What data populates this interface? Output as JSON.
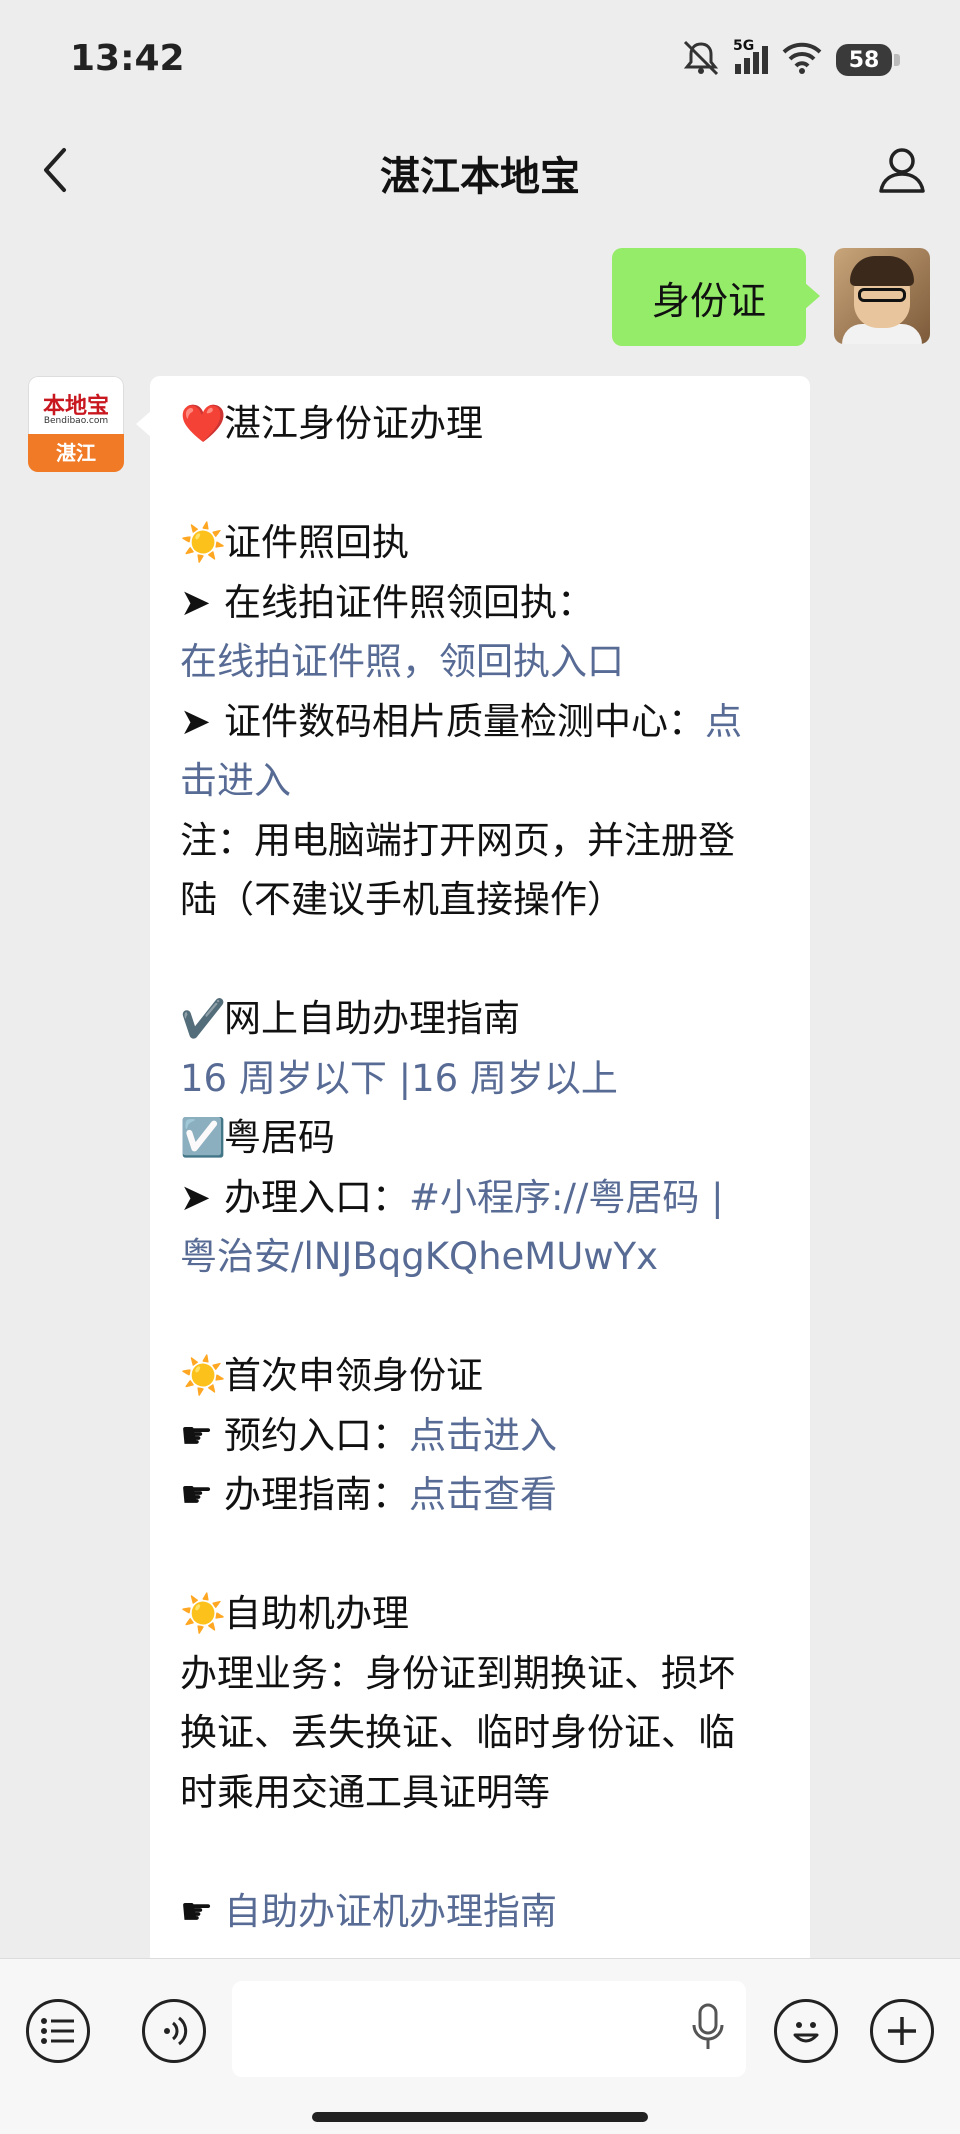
{
  "status": {
    "time": "13:42",
    "network": "5G",
    "battery": "58"
  },
  "nav": {
    "title": "湛江本地宝"
  },
  "outgoing": {
    "text": "身份证"
  },
  "bot_avatar": {
    "logo_text": "本地宝",
    "logo_sub": "Bendibao.com",
    "city": "湛江"
  },
  "message": {
    "lines": [
      {
        "icon": "❤️",
        "text": "湛江身份证办理"
      },
      {
        "text": ""
      },
      {
        "icon": "☀️",
        "text": "证件照回执"
      },
      {
        "prefix": "➤",
        "text": "在线拍证件照领回执："
      },
      {
        "link": "在线拍证件照，领回执入口"
      },
      {
        "prefix": "➤",
        "text": "证件数码相片质量检测中心：",
        "link": "点"
      },
      {
        "link": "击进入"
      },
      {
        "text": "注：用电脑端打开网页，并注册登"
      },
      {
        "text": "陆（不建议手机直接操作）"
      },
      {
        "text": ""
      },
      {
        "icon": "✔️",
        "text": "网上自助办理指南"
      },
      {
        "link": "16 周岁以下 |16 周岁以上"
      },
      {
        "icon": "☑️",
        "text": "粤居码"
      },
      {
        "prefix": "➤",
        "text": "办理入口：",
        "link": "#小程序://粤居码 |"
      },
      {
        "link": "粤治安/lNJBqgKQheMUwYx"
      },
      {
        "text": ""
      },
      {
        "icon": "☀️",
        "text": "首次申领身份证"
      },
      {
        "prefix": "☛",
        "text": "预约入口：",
        "link": "点击进入"
      },
      {
        "prefix": "☛",
        "text": "办理指南：",
        "link": "点击查看"
      },
      {
        "text": ""
      },
      {
        "icon": "☀️",
        "text": "自助机办理"
      },
      {
        "text": "办理业务：身份证到期换证、损坏"
      },
      {
        "text": "换证、丢失换证、临时身份证、临"
      },
      {
        "text": "时乘用交通工具证明等"
      },
      {
        "text": ""
      },
      {
        "prefix": "☛",
        "link": "自助办证机办理指南"
      }
    ]
  },
  "input": {
    "placeholder": ""
  }
}
